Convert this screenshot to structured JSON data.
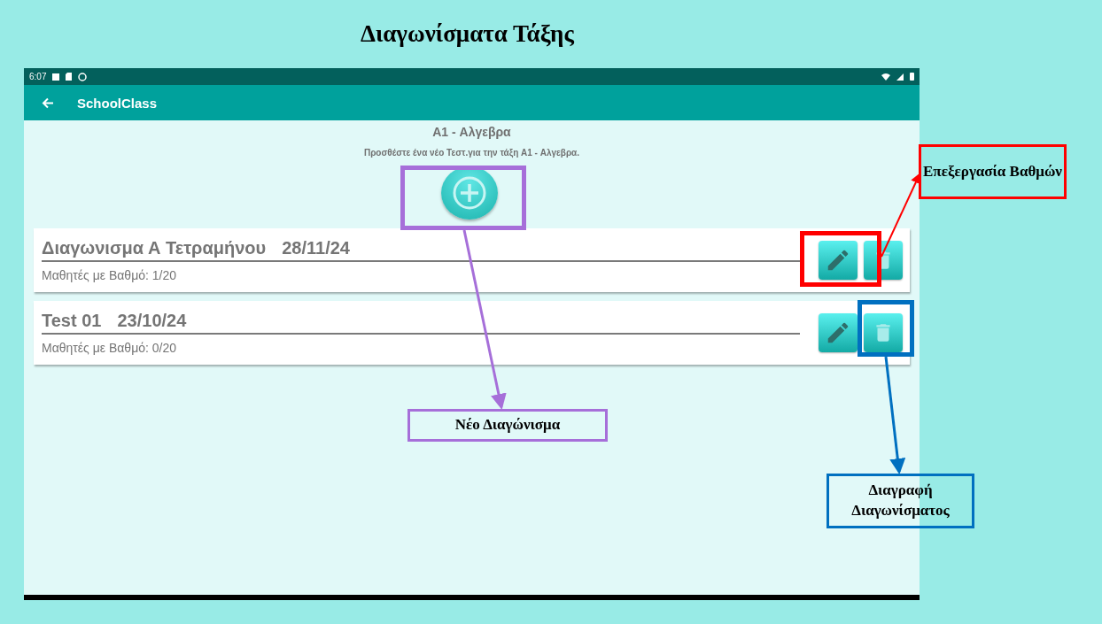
{
  "slide_title": "Διαγωνίσματα Τάξης",
  "status_bar": {
    "time": "6:07"
  },
  "app_bar": {
    "title": "SchoolClass"
  },
  "class_title": "A1 - Αλγεβρα",
  "add_hint": "Προσθέστε ένα νέο Τεστ.για την τάξη A1 - Αλγεβρα.",
  "tests": [
    {
      "name": "Διαγωνισμα Α Τετραμήνου",
      "date": "28/11/24",
      "graded": "Μαθητές με Βαθμό: 1/20"
    },
    {
      "name": "Test 01",
      "date": "23/10/24",
      "graded": "Μαθητές με Βαθμό: 0/20"
    }
  ],
  "annotations": [
    {
      "kind": "edit",
      "label": "Επεξεργασία Βαθμών",
      "color": "#ff0000"
    },
    {
      "kind": "new",
      "label": "Νέο Διαγώνισμα",
      "color": "#a66fd9"
    },
    {
      "kind": "delete",
      "label": "Διαγραφή Διαγωνίσματος",
      "color": "#0070c0"
    }
  ]
}
